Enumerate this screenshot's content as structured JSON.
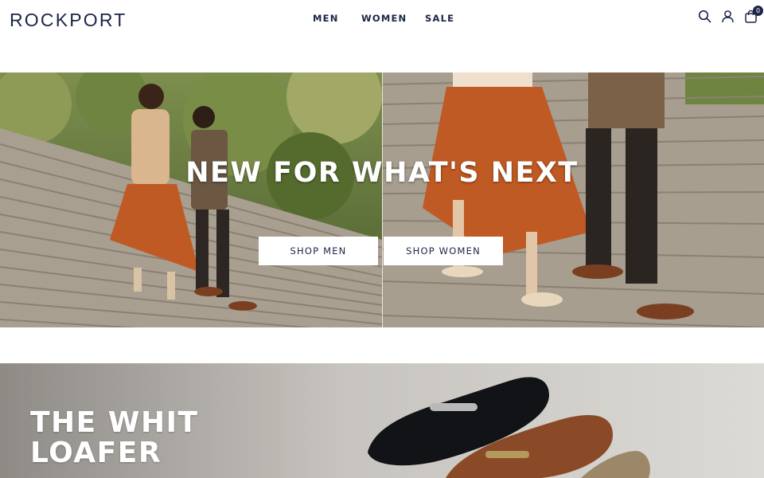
{
  "brand": {
    "logo_text": "ROCKPORT"
  },
  "nav": {
    "items": [
      "MEN",
      "WOMEN",
      "SALE"
    ]
  },
  "header_icons": {
    "search": "search-icon",
    "account": "user-icon",
    "cart": "shopping-bag-icon",
    "cart_count": "0"
  },
  "hero": {
    "title": "NEW FOR WHAT'S NEXT",
    "buttons": {
      "shop_men": "SHOP MEN",
      "shop_women": "SHOP WOMEN"
    }
  },
  "promo": {
    "title_line1": "THE WHIT",
    "title_line2": "LOAFER"
  },
  "colors": {
    "brand_navy": "#1b2547",
    "white": "#ffffff",
    "stone": "#a39a8c",
    "skirt_orange": "#c05a24"
  }
}
